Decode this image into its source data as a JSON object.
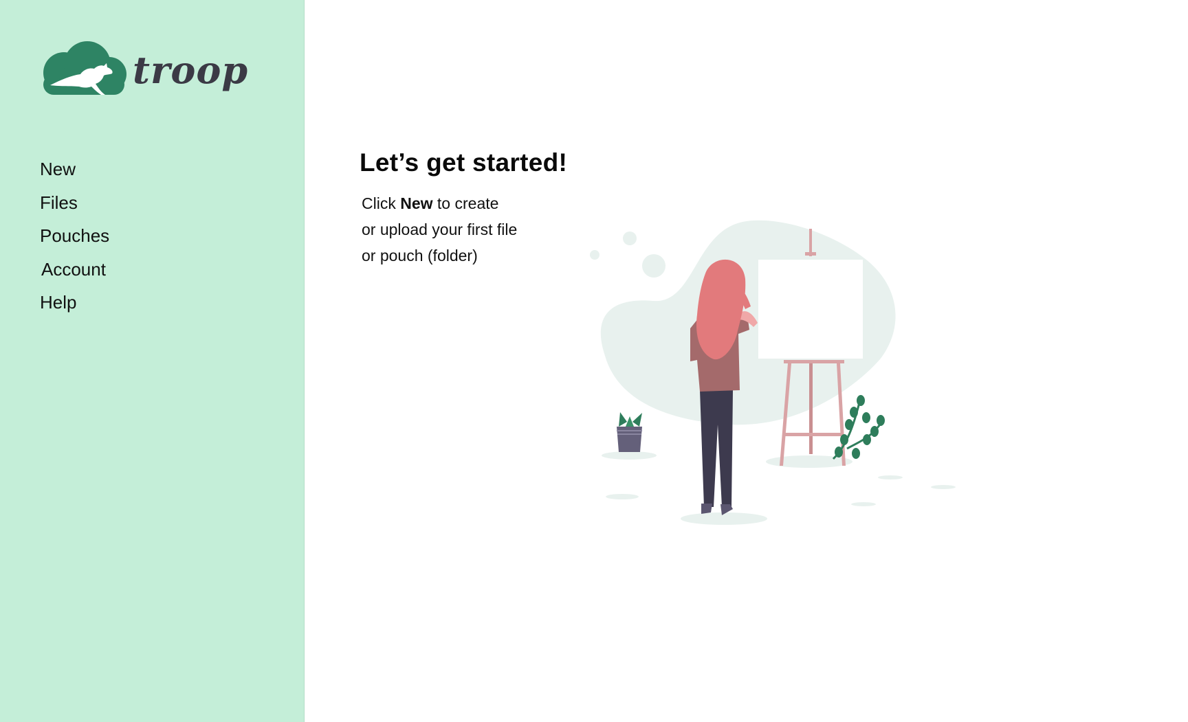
{
  "brand": {
    "name": "troop",
    "logo_icon": "kangaroo-cloud-icon",
    "colors": {
      "logo_green": "#2e8464",
      "sidebar_bg": "#c4eed8",
      "logo_text": "#3b3a45"
    }
  },
  "sidebar": {
    "items": [
      {
        "label": "New"
      },
      {
        "label": "Files"
      },
      {
        "label": "Pouches"
      },
      {
        "label": "Account"
      },
      {
        "label": "Help"
      }
    ]
  },
  "main": {
    "title": "Let’s get started!",
    "line1_prefix": "Click ",
    "line1_bold": "New",
    "line1_suffix": " to create",
    "line2": "or upload your first file",
    "line3": "or pouch (folder)",
    "illustration": "woman-painting-at-easel-illustration"
  }
}
